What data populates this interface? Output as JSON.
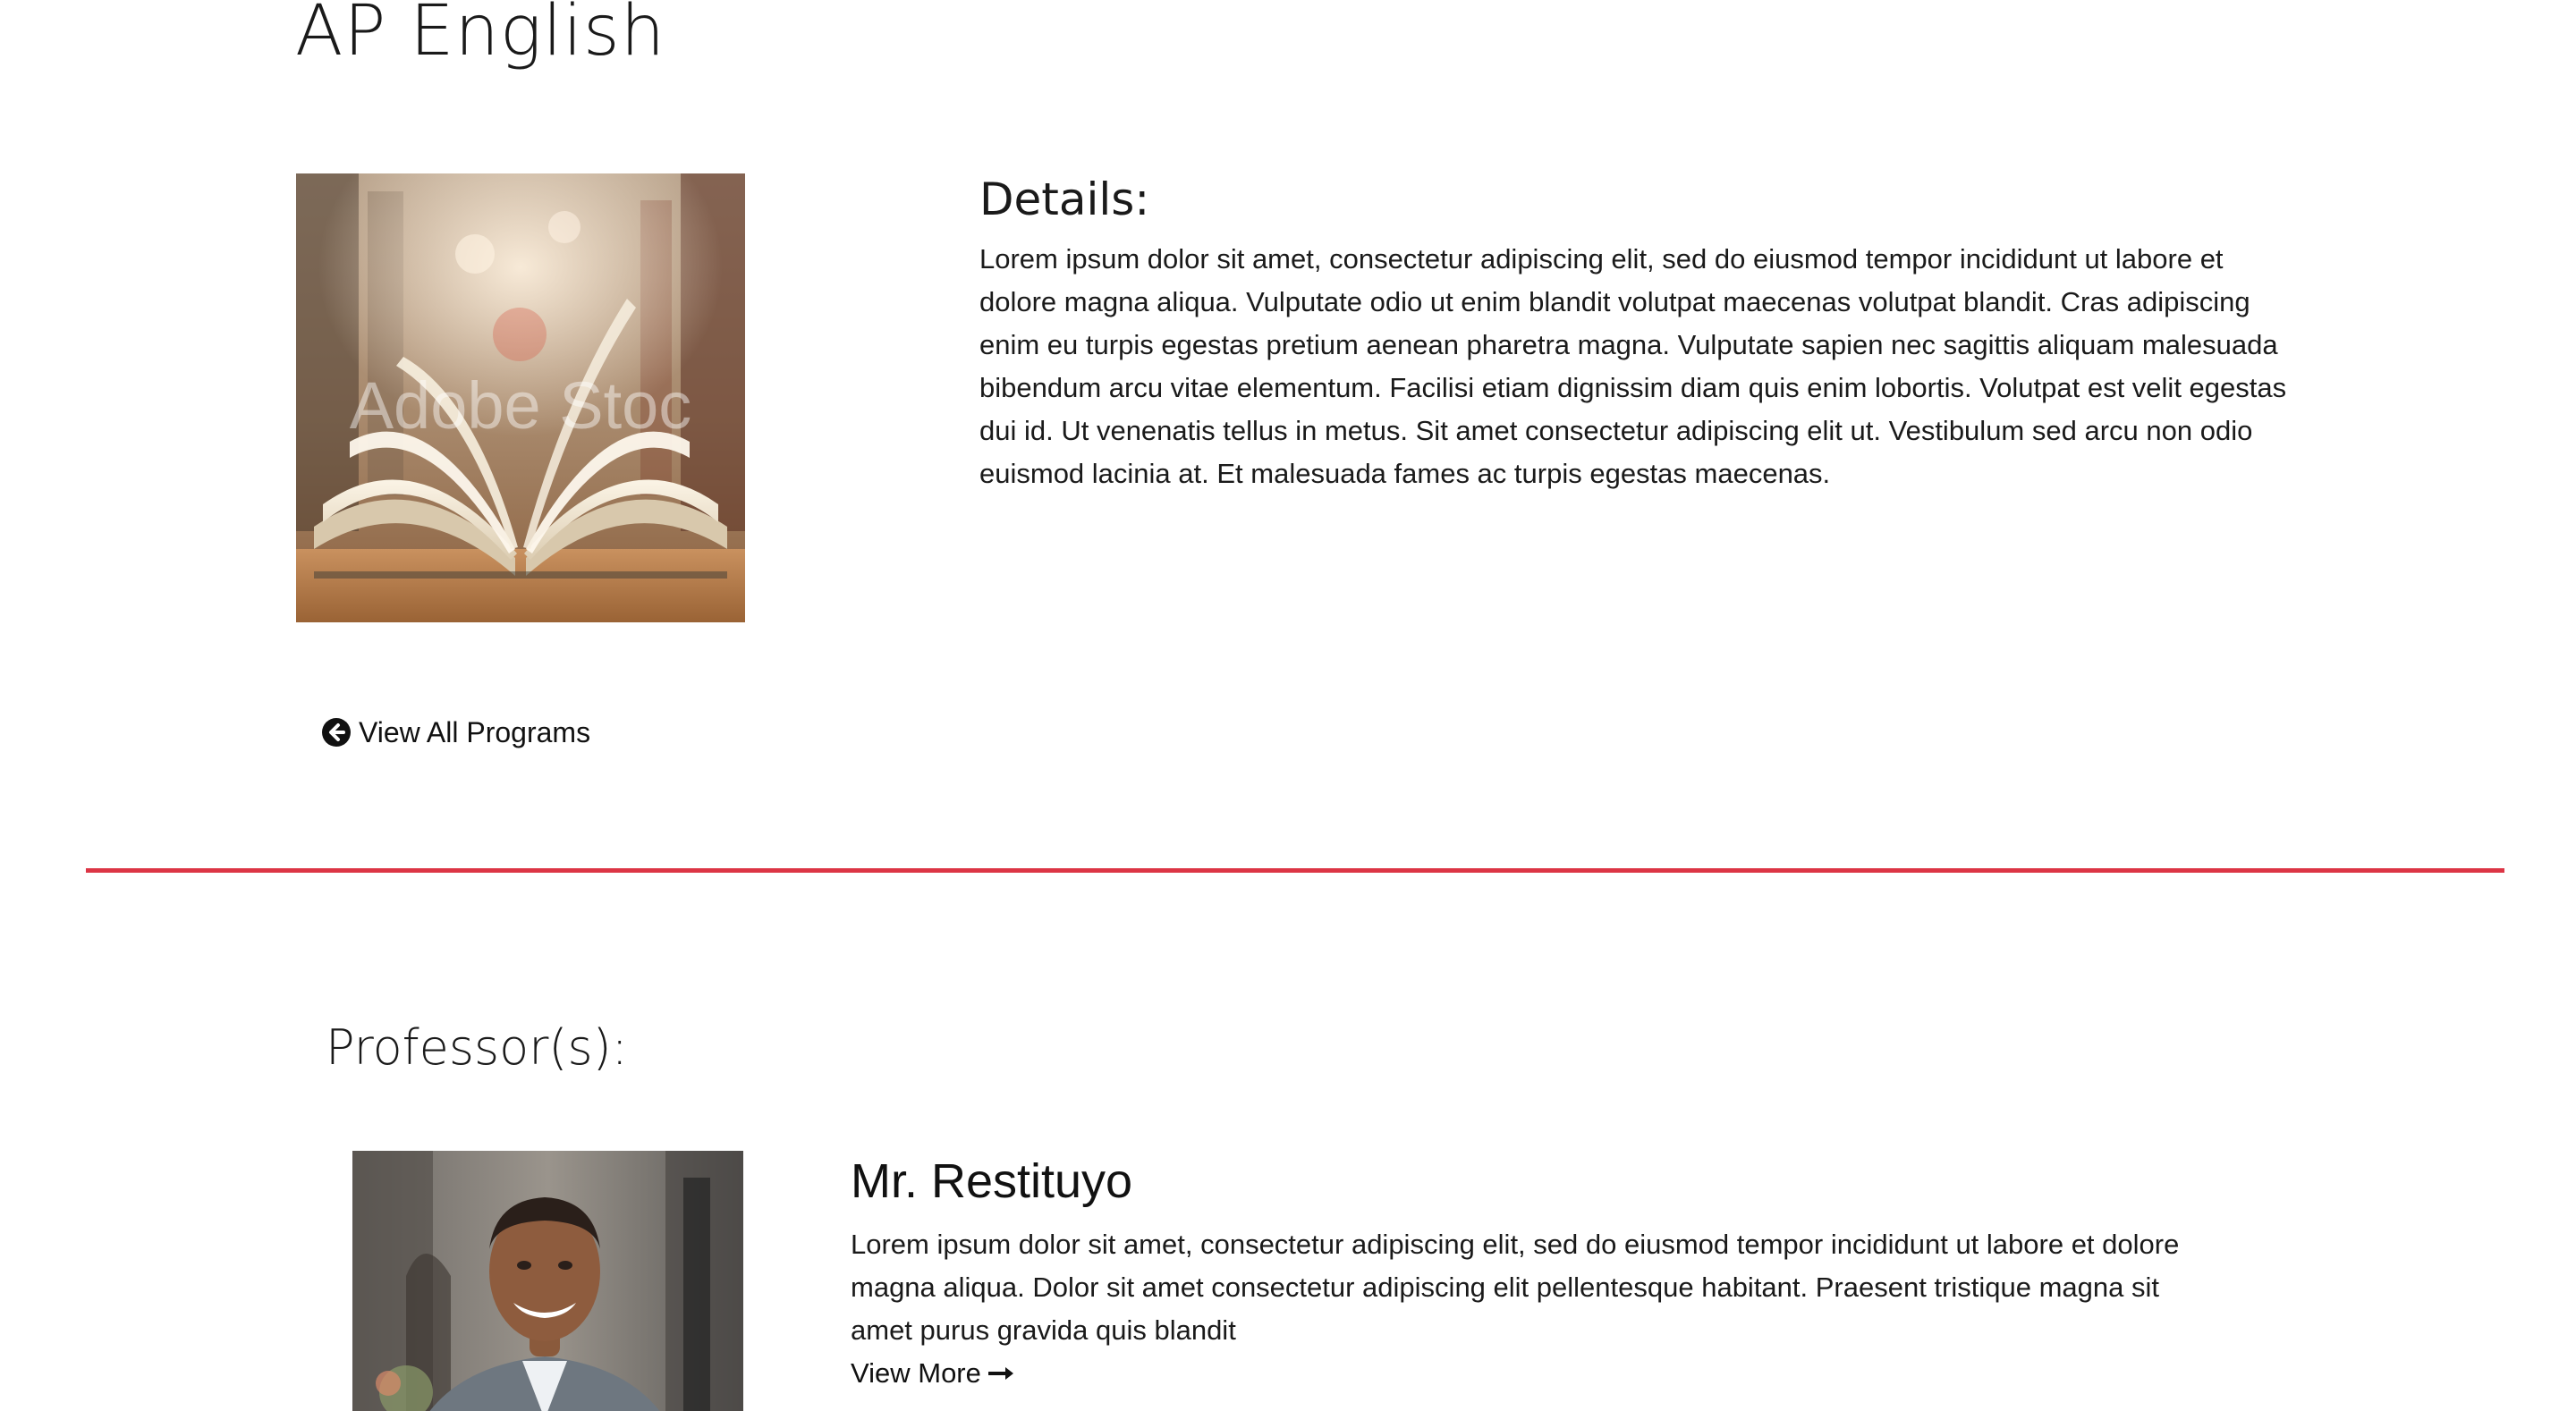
{
  "program": {
    "title": "AP English",
    "image_watermark": "Adobe Stoc"
  },
  "details": {
    "heading": "Details:",
    "text": "Lorem ipsum dolor sit amet, consectetur adipiscing elit, sed do eiusmod tempor incididunt ut labore et dolore magna aliqua. Vulputate odio ut enim blandit volutpat maecenas volutpat blandit. Cras adipiscing enim eu turpis egestas pretium aenean pharetra magna. Vulputate sapien nec sagittis aliquam malesuada bibendum arcu vitae elementum. Facilisi etiam dignissim diam quis enim lobortis. Volutpat est velit egestas dui id. Ut venenatis tellus in metus. Sit amet consectetur adipiscing elit ut. Vestibulum sed arcu non odio euismod lacinia at. Et malesuada fames ac turpis egestas maecenas."
  },
  "nav": {
    "back_label": "View All Programs",
    "back_icon": "arrow-circle-left-icon"
  },
  "divider": {
    "color": "#dc3545"
  },
  "professors": {
    "heading": "Professor(s):",
    "items": [
      {
        "name": "Mr. Restituyo",
        "bio": "Lorem ipsum dolor sit amet, consectetur adipiscing elit, sed do eiusmod tempor incididunt ut labore et dolore magna aliqua. Dolor sit amet consectetur adipiscing elit pellentesque habitant. Praesent tristique magna sit amet purus gravida quis blandit",
        "view_more_label": "View More",
        "view_more_icon": "long-arrow-right-icon"
      }
    ]
  }
}
